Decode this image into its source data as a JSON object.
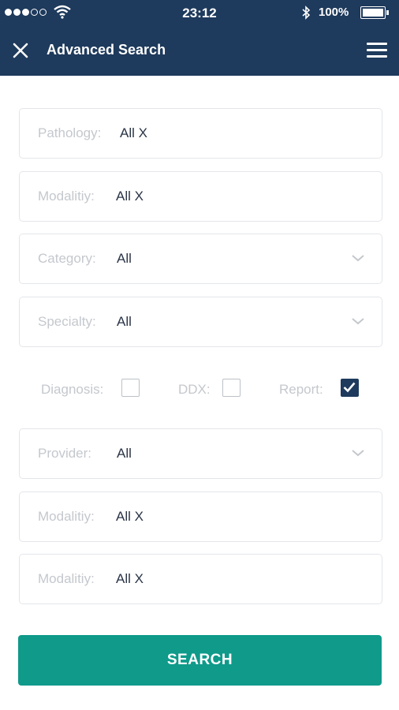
{
  "status": {
    "time": "23:12",
    "battery": "100%"
  },
  "header": {
    "title": "Advanced Search",
    "close_icon": "close-icon",
    "menu_icon": "hamburger-menu-icon",
    "background": "#1e3a5c"
  },
  "fields": [
    {
      "label": "Pathology:",
      "value": "All X",
      "dropdown": false
    },
    {
      "label": "Modalitiy:",
      "value": "All X",
      "dropdown": false
    },
    {
      "label": "Category:",
      "value": "All",
      "dropdown": true
    },
    {
      "label": "Specialty:",
      "value": "All",
      "dropdown": true
    },
    {
      "label": "Provider:",
      "value": "All",
      "dropdown": true
    },
    {
      "label": "Modalitiy:",
      "value": "All X",
      "dropdown": false
    },
    {
      "label": "Modalitiy:",
      "value": "All X",
      "dropdown": false
    }
  ],
  "checkboxes": [
    {
      "label": "Diagnosis:",
      "checked": false
    },
    {
      "label": "DDX:",
      "checked": false
    },
    {
      "label": "Report:",
      "checked": true
    }
  ],
  "search_button": {
    "label": "SEARCH",
    "color": "#0f9a8a"
  }
}
